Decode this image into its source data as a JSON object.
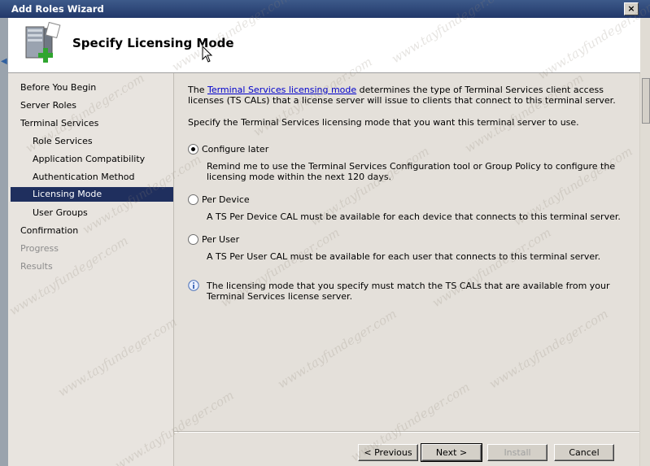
{
  "window": {
    "title": "Add Roles Wizard",
    "close_glyph": "×"
  },
  "header": {
    "title": "Specify Licensing Mode",
    "icon": "server-add-role-icon"
  },
  "nav": {
    "items": [
      {
        "label": "Before You Begin",
        "state": "normal",
        "level": 0
      },
      {
        "label": "Server Roles",
        "state": "normal",
        "level": 0
      },
      {
        "label": "Terminal Services",
        "state": "normal",
        "level": 0
      },
      {
        "label": "Role Services",
        "state": "normal",
        "level": 1
      },
      {
        "label": "Application Compatibility",
        "state": "normal",
        "level": 1
      },
      {
        "label": "Authentication Method",
        "state": "normal",
        "level": 1
      },
      {
        "label": "Licensing Mode",
        "state": "selected",
        "level": 1
      },
      {
        "label": "User Groups",
        "state": "normal",
        "level": 1
      },
      {
        "label": "Confirmation",
        "state": "normal",
        "level": 0
      },
      {
        "label": "Progress",
        "state": "disabled",
        "level": 0
      },
      {
        "label": "Results",
        "state": "disabled",
        "level": 0
      }
    ]
  },
  "content": {
    "intro_prefix": "The ",
    "intro_link": "Terminal Services licensing mode",
    "intro_suffix": " determines the type of Terminal Services client access licenses (TS CALs) that a license server will issue to clients that connect to this terminal server.",
    "instruction": "Specify the Terminal Services licensing mode that you want this terminal server to use.",
    "options": [
      {
        "label": "Configure later",
        "checked": true,
        "description": "Remind me to use the Terminal Services Configuration tool or Group Policy to configure the licensing mode within the next 120 days."
      },
      {
        "label": "Per Device",
        "checked": false,
        "description": "A TS Per Device CAL must be available for each device that connects to this terminal server."
      },
      {
        "label": "Per User",
        "checked": false,
        "description": "A TS Per User CAL must be available for each user that connects to this terminal server."
      }
    ],
    "info_note": "The licensing mode that you specify must match the TS CALs that are available from your Terminal Services license server."
  },
  "buttons": {
    "previous": "< Previous",
    "next": "Next >",
    "install": "Install",
    "cancel": "Cancel"
  },
  "watermark": "www.tayfundeger.com"
}
